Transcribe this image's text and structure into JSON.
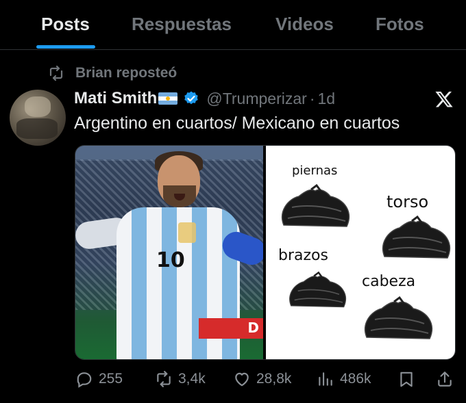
{
  "tabs": [
    {
      "label": "Posts",
      "active": true
    },
    {
      "label": "Respuestas",
      "active": false
    },
    {
      "label": "Videos",
      "active": false
    },
    {
      "label": "Fotos",
      "active": false
    }
  ],
  "repost": {
    "icon": "repost-icon",
    "text": "Brian reposteó"
  },
  "post": {
    "author_name": "Mati Smith",
    "flag": "argentina-flag-emoji",
    "handle": "@Trumperizar",
    "separator": "·",
    "time": "1d",
    "text": "Argentino en cuartos/ Mexicano en cuartos",
    "media": {
      "left": {
        "description_icon": "soccer-player-photo",
        "ad_board_text": "D"
      },
      "right": {
        "labels": [
          "piernas",
          "torso",
          "brazos",
          "cabeza"
        ]
      }
    }
  },
  "actions": {
    "replies": "255",
    "reposts": "3,4k",
    "likes": "28,8k",
    "views": "486k"
  },
  "colors": {
    "accent": "#1d9bf0",
    "muted": "#71767b",
    "text": "#e7e9ea",
    "background": "#000000"
  }
}
